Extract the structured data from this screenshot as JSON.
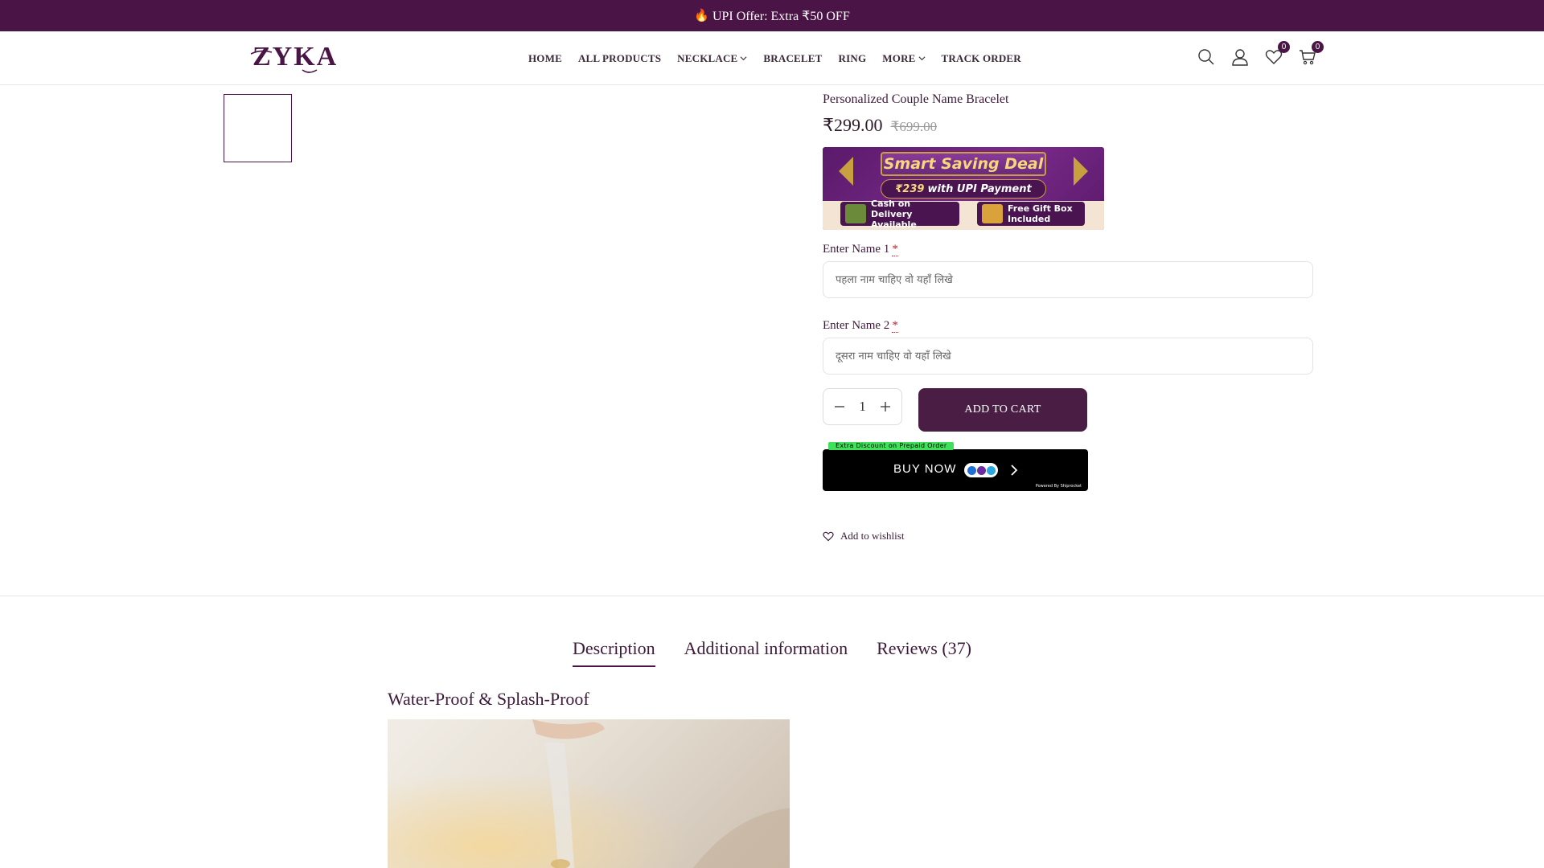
{
  "announcement": {
    "icon": "fire-icon",
    "text": "🔥",
    "offer": "UPI Offer: Extra ₹50 OFF"
  },
  "header": {
    "logo_text": "ZYKA",
    "nav": [
      {
        "label": "HOME"
      },
      {
        "label": "ALL PRODUCTS"
      },
      {
        "label": "NECKLACE",
        "dropdown": true
      },
      {
        "label": "BRACELET"
      },
      {
        "label": "RING"
      },
      {
        "label": "MORE",
        "dropdown": true
      },
      {
        "label": "TRACK ORDER"
      }
    ],
    "wishlist_count": "0",
    "cart_count": "0"
  },
  "product": {
    "title": "Personalized Couple Name Bracelet",
    "price": "₹299.00",
    "old_price": "₹699.00",
    "deal_banner": {
      "headline": "Smart Saving Deal",
      "upi_amount": "₹239",
      "upi_text": "with UPI Payment",
      "cod": "Cash on Delivery Available",
      "gift": "Free Gift Box Included"
    },
    "name1_label": "Enter Name 1",
    "name1_placeholder": "पहला नाम चाहिए वो यहाँ लिखे",
    "name2_label": "Enter Name 2",
    "name2_placeholder": "दूसरा नाम चाहिए वो यहाँ लिखे",
    "required_mark": "*",
    "quantity": "1",
    "add_to_cart": "ADD TO CART",
    "buy_now_tag": "Extra Discount on Prepaid Order",
    "buy_now": "BUY NOW",
    "powered_by": "Powered By Shiprocket",
    "add_to_wishlist": "Add to wishlist"
  },
  "tabs": [
    {
      "label": "Description",
      "active": true
    },
    {
      "label": "Additional information",
      "active": false
    },
    {
      "label": "Reviews (37)",
      "active": false
    }
  ],
  "description": {
    "heading": "Water-Proof & Splash-Proof"
  },
  "colors": {
    "brand": "#4b1446",
    "buy_now_bg": "#000000",
    "tag_green": "#3fe05a"
  }
}
